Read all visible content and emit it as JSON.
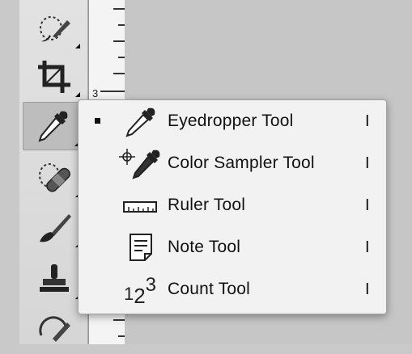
{
  "toolbar": {
    "tools": [
      {
        "name": "quick-selection-icon"
      },
      {
        "name": "crop-icon"
      },
      {
        "name": "eyedropper-icon",
        "active": true
      },
      {
        "name": "spot-healing-icon"
      },
      {
        "name": "brush-icon"
      },
      {
        "name": "clone-stamp-icon"
      },
      {
        "name": "history-brush-icon"
      }
    ]
  },
  "ruler": {
    "number": "3"
  },
  "flyout_menu": {
    "items": [
      {
        "label": "Eyedropper Tool",
        "shortcut": "I",
        "icon": "eyedropper-icon",
        "selected": true
      },
      {
        "label": "Color Sampler Tool",
        "shortcut": "I",
        "icon": "color-sampler-icon",
        "selected": false
      },
      {
        "label": "Ruler Tool",
        "shortcut": "I",
        "icon": "ruler-icon",
        "selected": false
      },
      {
        "label": "Note Tool",
        "shortcut": "I",
        "icon": "note-icon",
        "selected": false
      },
      {
        "label": "Count Tool",
        "shortcut": "I",
        "icon": "count-icon",
        "selected": false
      }
    ],
    "count_icon_digits": [
      "1",
      "2",
      "3"
    ]
  }
}
